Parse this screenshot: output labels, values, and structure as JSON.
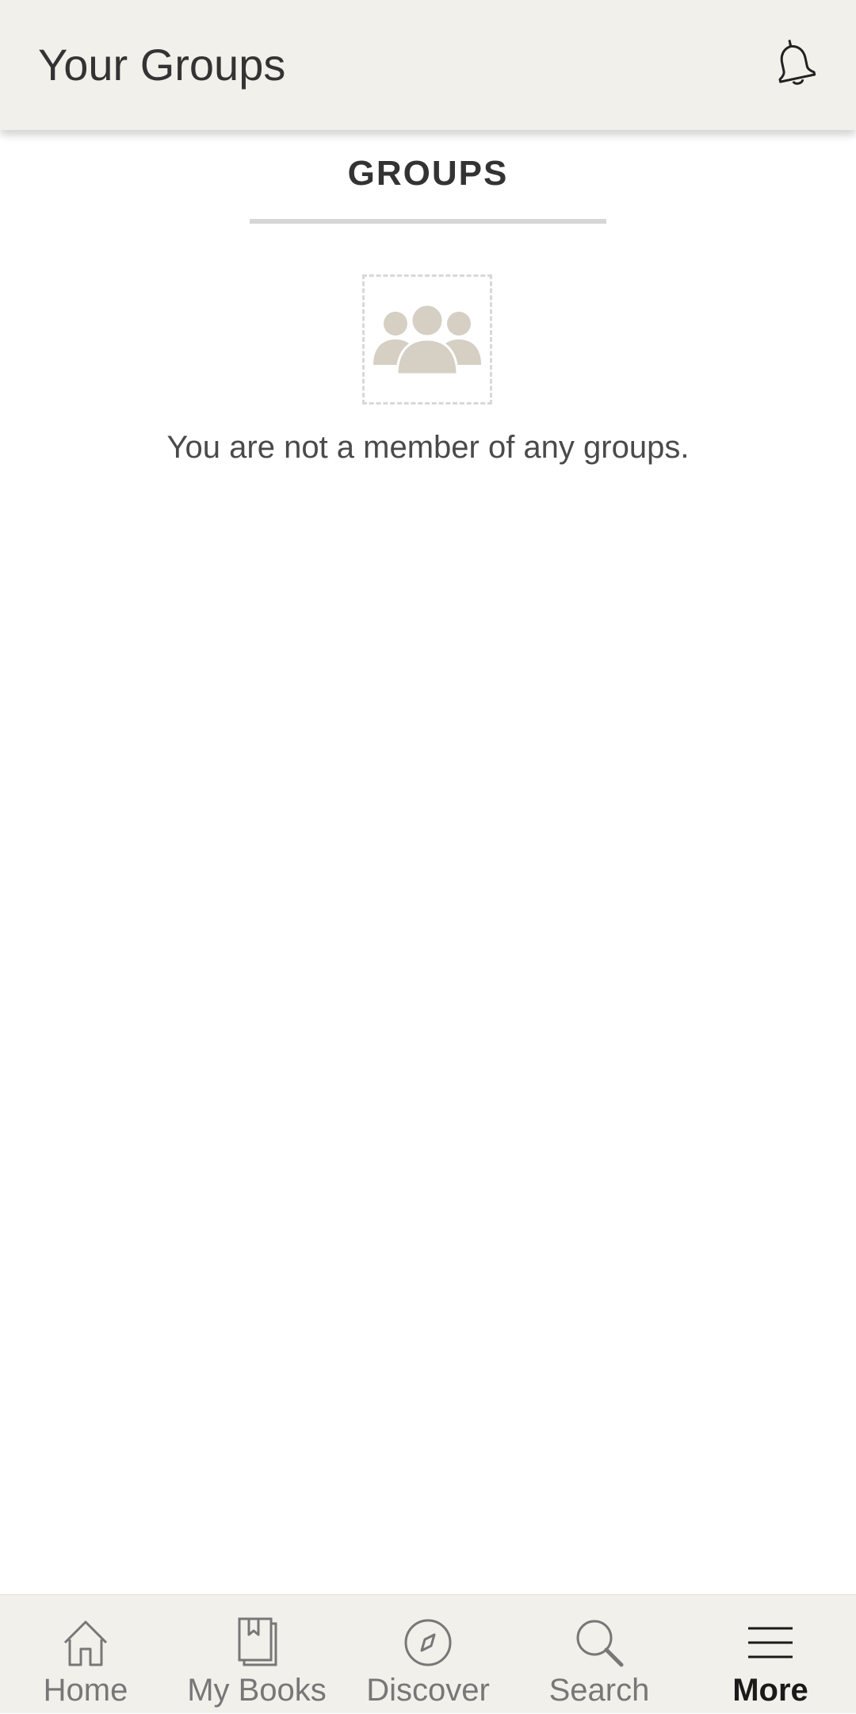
{
  "header": {
    "title": "Your Groups",
    "notifications_icon": "bell-icon"
  },
  "tabs": [
    {
      "label": "GROUPS",
      "active": true
    }
  ],
  "empty_state": {
    "icon": "group-placeholder-icon",
    "message": "You are not a member of any groups."
  },
  "bottom_nav": {
    "items": [
      {
        "label": "Home",
        "icon": "home-icon",
        "active": false
      },
      {
        "label": "My Books",
        "icon": "my-books-icon",
        "active": false
      },
      {
        "label": "Discover",
        "icon": "compass-icon",
        "active": false
      },
      {
        "label": "Search",
        "icon": "search-icon",
        "active": false
      },
      {
        "label": "More",
        "icon": "menu-icon",
        "active": true
      }
    ]
  },
  "colors": {
    "bar_background": "#f2f0eb",
    "text_primary": "#333333",
    "icon_placeholder": "#d5cfc4",
    "nav_inactive": "#777777",
    "nav_active": "#1a1a1a"
  }
}
